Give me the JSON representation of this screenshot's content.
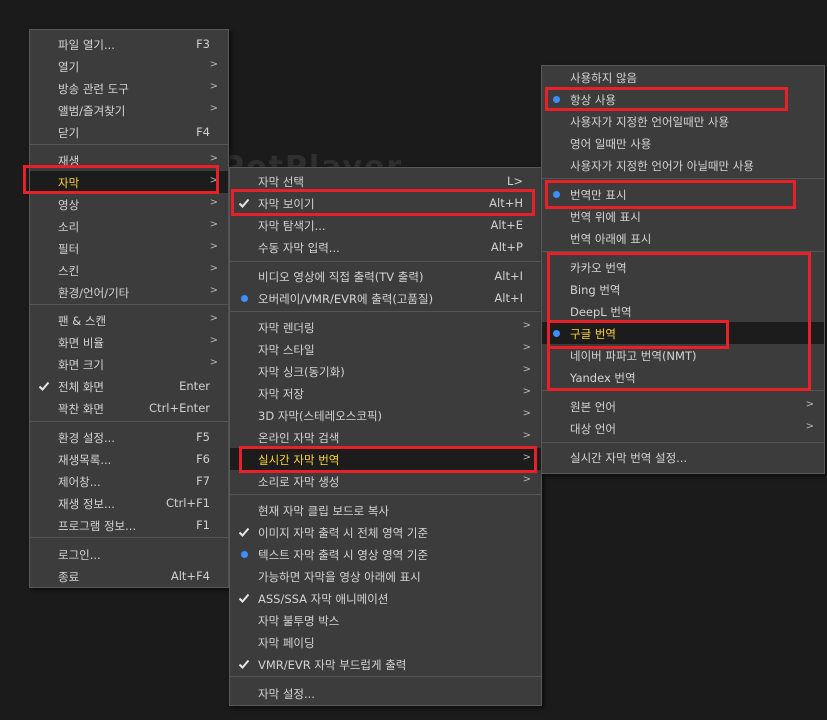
{
  "background_text": "PotPlayer",
  "main_menu": {
    "items": [
      {
        "label": "파일 열기...",
        "shortcut": "F3"
      },
      {
        "label": "열기",
        "shortcut": ">"
      },
      {
        "label": "방송 관련 도구",
        "shortcut": ">"
      },
      {
        "label": "앨범/즐겨찾기",
        "shortcut": ">"
      },
      {
        "label": "닫기",
        "shortcut": "F4"
      },
      {
        "label": "재생",
        "shortcut": ">"
      },
      {
        "label": "자막",
        "shortcut": ">"
      },
      {
        "label": "영상",
        "shortcut": ">"
      },
      {
        "label": "소리",
        "shortcut": ">"
      },
      {
        "label": "필터",
        "shortcut": ">"
      },
      {
        "label": "스킨",
        "shortcut": ">"
      },
      {
        "label": "환경/언어/기타",
        "shortcut": ">"
      },
      {
        "label": "팬 & 스캔",
        "shortcut": ">"
      },
      {
        "label": "화면 비율",
        "shortcut": ">"
      },
      {
        "label": "화면 크기",
        "shortcut": ">"
      },
      {
        "label": "전체 화면",
        "shortcut": "Enter"
      },
      {
        "label": "꽉찬 화면",
        "shortcut": "Ctrl+Enter"
      },
      {
        "label": "환경 설정...",
        "shortcut": "F5"
      },
      {
        "label": "재생목록...",
        "shortcut": "F6"
      },
      {
        "label": "제어창...",
        "shortcut": "F7"
      },
      {
        "label": "재생 정보...",
        "shortcut": "Ctrl+F1"
      },
      {
        "label": "프로그램 정보...",
        "shortcut": "F1"
      },
      {
        "label": "로그인...",
        "shortcut": ""
      },
      {
        "label": "종료",
        "shortcut": "Alt+F4"
      }
    ]
  },
  "subtitle_menu": {
    "items": [
      {
        "label": "자막 선택",
        "shortcut": "L>"
      },
      {
        "label": "자막 보이기",
        "shortcut": "Alt+H"
      },
      {
        "label": "자막 탐색기...",
        "shortcut": "Alt+E"
      },
      {
        "label": "수동 자막 입력...",
        "shortcut": "Alt+P"
      },
      {
        "label": "비디오 영상에 직접 출력(TV 출력)",
        "shortcut": "Alt+I"
      },
      {
        "label": "오버레이/VMR/EVR에 출력(고품질)",
        "shortcut": "Alt+I"
      },
      {
        "label": "자막 렌더링",
        "shortcut": ">"
      },
      {
        "label": "자막 스타일",
        "shortcut": ">"
      },
      {
        "label": "자막 싱크(동기화)",
        "shortcut": ">"
      },
      {
        "label": "자막 저장",
        "shortcut": ">"
      },
      {
        "label": "3D 자막(스테레오스코픽)",
        "shortcut": ">"
      },
      {
        "label": "온라인 자막 검색",
        "shortcut": ">"
      },
      {
        "label": "실시간 자막 번역",
        "shortcut": ">"
      },
      {
        "label": "소리로 자막 생성",
        "shortcut": ">"
      },
      {
        "label": "현재 자막 클립 보드로 복사",
        "shortcut": ""
      },
      {
        "label": "이미지 자막 출력 시 전체 영역 기준",
        "shortcut": ""
      },
      {
        "label": "텍스트 자막 출력 시 영상 영역 기준",
        "shortcut": ""
      },
      {
        "label": "가능하면 자막을 영상 아래에 표시",
        "shortcut": ""
      },
      {
        "label": "ASS/SSA 자막 애니메이션",
        "shortcut": ""
      },
      {
        "label": "자막 불투명 박스",
        "shortcut": ""
      },
      {
        "label": "자막 페이딩",
        "shortcut": ""
      },
      {
        "label": "VMR/EVR 자막 부드럽게 출력",
        "shortcut": ""
      },
      {
        "label": "자막 설정...",
        "shortcut": ""
      }
    ]
  },
  "translate_menu": {
    "items": [
      {
        "label": "사용하지 않음",
        "shortcut": ""
      },
      {
        "label": "항상 사용",
        "shortcut": ""
      },
      {
        "label": "사용자가 지정한 언어일때만 사용",
        "shortcut": ""
      },
      {
        "label": "영어 일때만 사용",
        "shortcut": ""
      },
      {
        "label": "사용자가 지정한 언어가 아닐때만 사용",
        "shortcut": ""
      },
      {
        "label": "번역만 표시",
        "shortcut": ""
      },
      {
        "label": "번역 위에 표시",
        "shortcut": ""
      },
      {
        "label": "번역 아래에 표시",
        "shortcut": ""
      },
      {
        "label": "카카오 번역",
        "shortcut": ""
      },
      {
        "label": "Bing 번역",
        "shortcut": ""
      },
      {
        "label": "DeepL 번역",
        "shortcut": ""
      },
      {
        "label": "구글 번역",
        "shortcut": ""
      },
      {
        "label": "네이버 파파고 번역(NMT)",
        "shortcut": ""
      },
      {
        "label": "Yandex 번역",
        "shortcut": ""
      },
      {
        "label": "원본 언어",
        "shortcut": ">"
      },
      {
        "label": "대상 언어",
        "shortcut": ">"
      },
      {
        "label": "실시간 자막 번역 설정...",
        "shortcut": ""
      }
    ]
  }
}
